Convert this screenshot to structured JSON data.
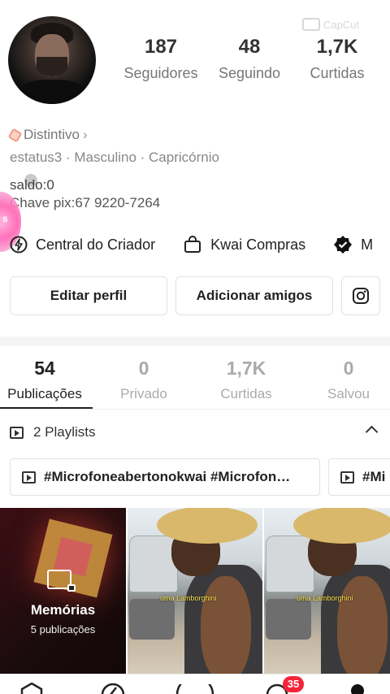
{
  "profile": {
    "stats": [
      {
        "value": "187",
        "label": "Seguidores"
      },
      {
        "value": "48",
        "label": "Seguindo"
      },
      {
        "value": "1,7K",
        "label": "Curtidas"
      }
    ],
    "watermark": "CapCut",
    "badge_label": "Distintivo",
    "meta_line": "estatus3 · Masculino · Capricórnio",
    "bio_line1": "saldo:0",
    "bio_line2": "Chave pix:67 9220-7264",
    "sticker_text": "s"
  },
  "links": [
    {
      "label": "Central do Criador",
      "icon": "lightning-icon"
    },
    {
      "label": "Kwai Compras",
      "icon": "shopping-bag-icon"
    },
    {
      "label": "M",
      "icon": "verified-badge-icon"
    }
  ],
  "buttons": {
    "edit_profile": "Editar perfil",
    "add_friends": "Adicionar amigos",
    "instagram": "instagram-icon"
  },
  "tabs": [
    {
      "value": "54",
      "label": "Publicações",
      "active": true
    },
    {
      "value": "0",
      "label": "Privado",
      "active": false
    },
    {
      "value": "1,7K",
      "label": "Curtidas",
      "active": false
    },
    {
      "value": "0",
      "label": "Salvou",
      "active": false
    }
  ],
  "playlists": {
    "header": "2 Playlists",
    "items": [
      "#Microfoneabertonokwai #Microfon…",
      "#Mi"
    ]
  },
  "grid": {
    "memories_title": "Memórias",
    "memories_sub": "5 publicações",
    "video_caption": "uma Lamborghini"
  },
  "nav": {
    "inbox_badge": "35"
  }
}
